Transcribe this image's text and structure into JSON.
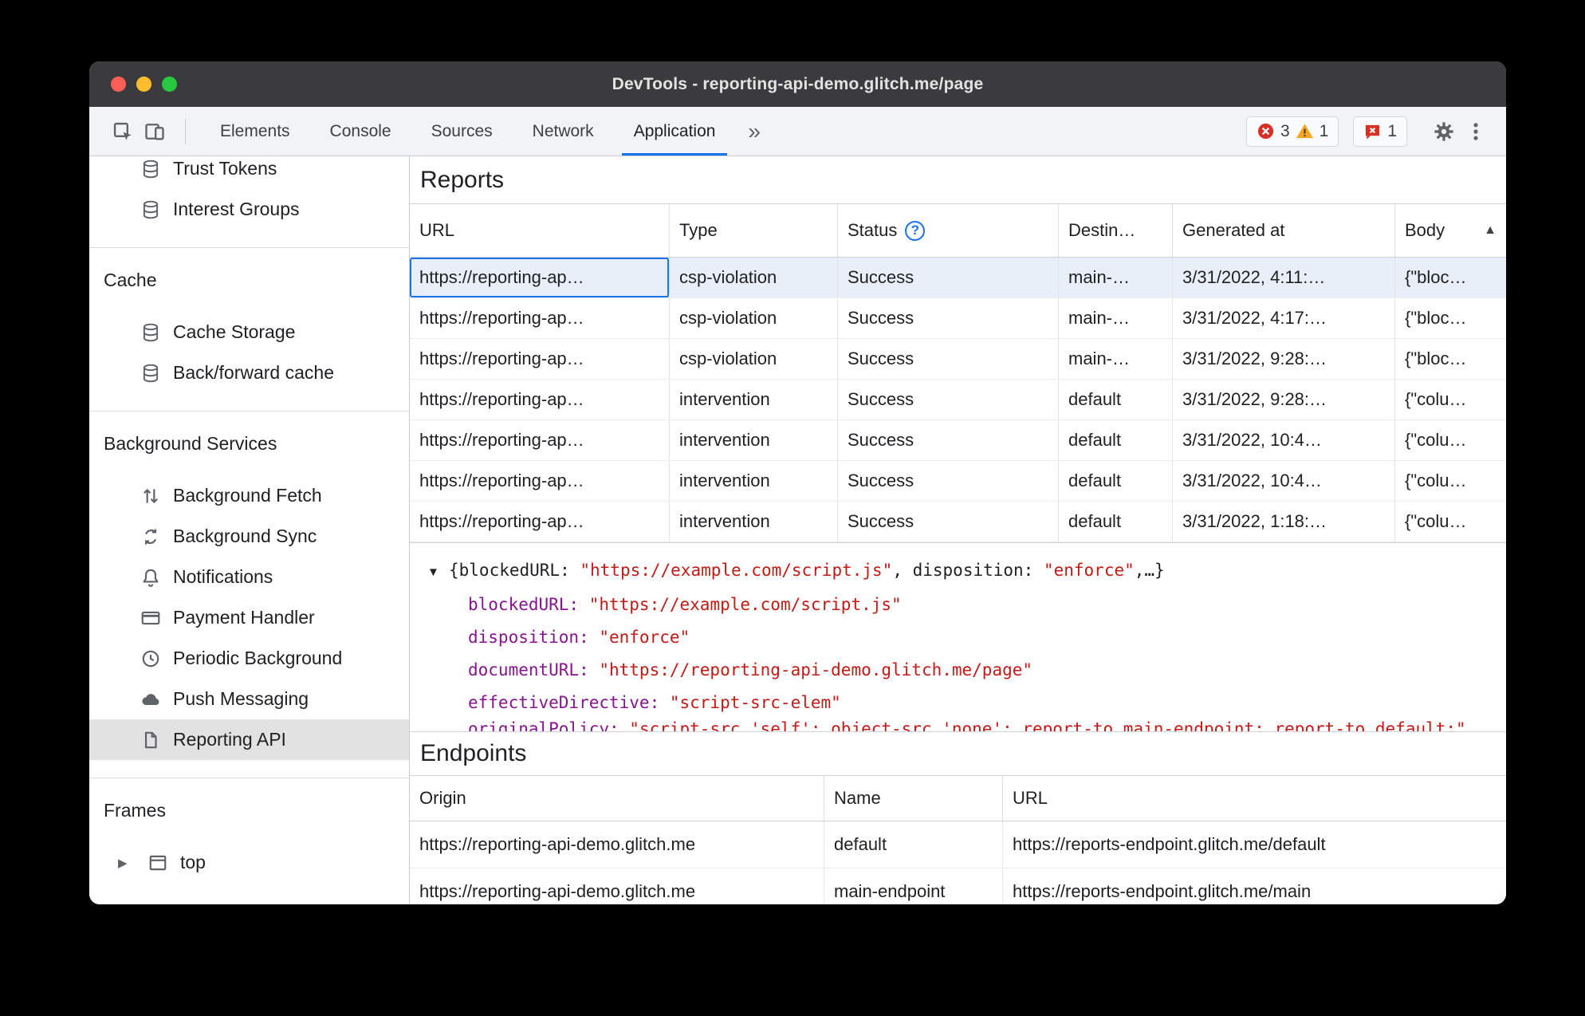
{
  "colors": {
    "accent": "#1a73e8",
    "error-red": "#d93025",
    "warning-yellow": "#f5a623",
    "json-key-purple": "#881391",
    "json-string-red": "#c41a16",
    "selection-gray": "#e2e2e2",
    "selected-row-blue": "#e9eff8"
  },
  "window": {
    "title": "DevTools - reporting-api-demo.glitch.me/page"
  },
  "toolbar": {
    "tabs": [
      "Elements",
      "Console",
      "Sources",
      "Network",
      "Application"
    ],
    "selected_tab": "Application",
    "more_tabs_label": "»",
    "error_count": "3",
    "warning_count": "1",
    "issue_count": "1"
  },
  "sidebar": {
    "top_items": [
      {
        "label": "Trust Tokens",
        "icon": "database"
      },
      {
        "label": "Interest Groups",
        "icon": "database"
      }
    ],
    "sections": [
      {
        "header": "Cache",
        "items": [
          {
            "label": "Cache Storage",
            "icon": "database"
          },
          {
            "label": "Back/forward cache",
            "icon": "database"
          }
        ]
      },
      {
        "header": "Background Services",
        "items": [
          {
            "label": "Background Fetch",
            "icon": "arrows"
          },
          {
            "label": "Background Sync",
            "icon": "sync"
          },
          {
            "label": "Notifications",
            "icon": "bell"
          },
          {
            "label": "Payment Handler",
            "icon": "card"
          },
          {
            "label": "Periodic Background",
            "icon": "clock"
          },
          {
            "label": "Push Messaging",
            "icon": "cloud"
          },
          {
            "label": "Reporting API",
            "icon": "file",
            "selected": true
          }
        ]
      },
      {
        "header": "Frames",
        "items": [
          {
            "label": "top",
            "icon": "frame",
            "disclosure": true
          }
        ]
      }
    ]
  },
  "reports": {
    "heading": "Reports",
    "columns": [
      {
        "label": "URL"
      },
      {
        "label": "Type"
      },
      {
        "label": "Status",
        "help": true
      },
      {
        "label": "Destin…"
      },
      {
        "label": "Generated at"
      },
      {
        "label": "Body",
        "sort": "asc"
      }
    ],
    "selected_row": 0,
    "rows": [
      [
        "https://reporting-ap…",
        "csp-violation",
        "Success",
        "main-…",
        "3/31/2022, 4:11:…",
        "{\"bloc…"
      ],
      [
        "https://reporting-ap…",
        "csp-violation",
        "Success",
        "main-…",
        "3/31/2022, 4:17:…",
        "{\"bloc…"
      ],
      [
        "https://reporting-ap…",
        "csp-violation",
        "Success",
        "main-…",
        "3/31/2022, 9:28:…",
        "{\"bloc…"
      ],
      [
        "https://reporting-ap…",
        "intervention",
        "Success",
        "default",
        "3/31/2022, 9:28:…",
        "{\"colu…"
      ],
      [
        "https://reporting-ap…",
        "intervention",
        "Success",
        "default",
        "3/31/2022, 10:4…",
        "{\"colu…"
      ],
      [
        "https://reporting-ap…",
        "intervention",
        "Success",
        "default",
        "3/31/2022, 10:4…",
        "{\"colu…"
      ],
      [
        "https://reporting-ap…",
        "intervention",
        "Success",
        "default",
        "3/31/2022, 1:18:…",
        "{\"colu…"
      ]
    ]
  },
  "preview": {
    "summary_segments": [
      {
        "style": "plain",
        "text": "{blockedURL: "
      },
      {
        "style": "string",
        "text": "\"https://example.com/script.js\""
      },
      {
        "style": "plain",
        "text": ", disposition: "
      },
      {
        "style": "string",
        "text": "\"enforce\""
      },
      {
        "style": "plain",
        "text": ",…}"
      }
    ],
    "properties": [
      {
        "name": "blockedURL",
        "value": "\"https://example.com/script.js\""
      },
      {
        "name": "disposition",
        "value": "\"enforce\""
      },
      {
        "name": "documentURL",
        "value": "\"https://reporting-api-demo.glitch.me/page\""
      },
      {
        "name": "effectiveDirective",
        "value": "\"script-src-elem\""
      }
    ],
    "clipped_property": {
      "name": "originalPolicy",
      "value": "\"script-src 'self'; object-src 'none'; report-to main-endpoint; report-to default;\""
    }
  },
  "endpoints": {
    "heading": "Endpoints",
    "columns": [
      "Origin",
      "Name",
      "URL"
    ],
    "rows": [
      [
        "https://reporting-api-demo.glitch.me",
        "default",
        "https://reports-endpoint.glitch.me/default"
      ],
      [
        "https://reporting-api-demo.glitch.me",
        "main-endpoint",
        "https://reports-endpoint.glitch.me/main"
      ]
    ]
  }
}
